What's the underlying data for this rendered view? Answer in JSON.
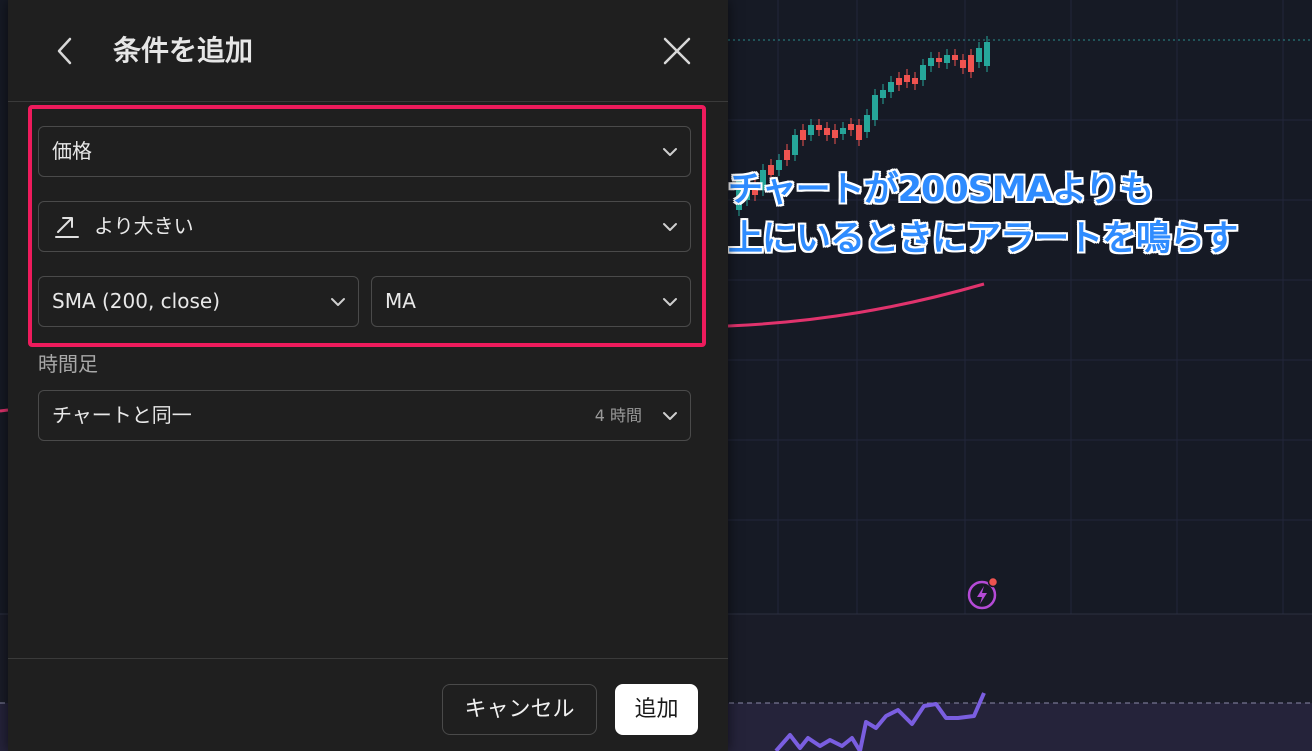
{
  "panel": {
    "title": "条件を追加",
    "condition": {
      "source": "価格",
      "operator": "より大きい",
      "target_indicator": "SMA (200, close)",
      "target_series": "MA"
    },
    "timeframe": {
      "label": "時間足",
      "value": "チャートと同一",
      "hint": "4 時間"
    },
    "footer": {
      "cancel_label": "キャンセル",
      "add_label": "追加"
    }
  },
  "annotation": {
    "line1": "チャートが200SMAよりも",
    "line2": "上にいるときにアラートを鳴らす"
  },
  "colors": {
    "highlight": "#ee1b5c",
    "annotation_text": "#2f8cff",
    "sma_line": "#e0336d",
    "oscillator_line": "#7a5ee0",
    "candle_up": "#26a69a",
    "candle_down": "#ef5350",
    "alert_icon": "#b44ad6"
  },
  "icons": {
    "back": "chevron-left-icon",
    "close": "close-icon",
    "operator": "trend-up-arrow-icon",
    "dropdown": "chevron-down-icon",
    "alert": "lightning-alert-icon"
  }
}
